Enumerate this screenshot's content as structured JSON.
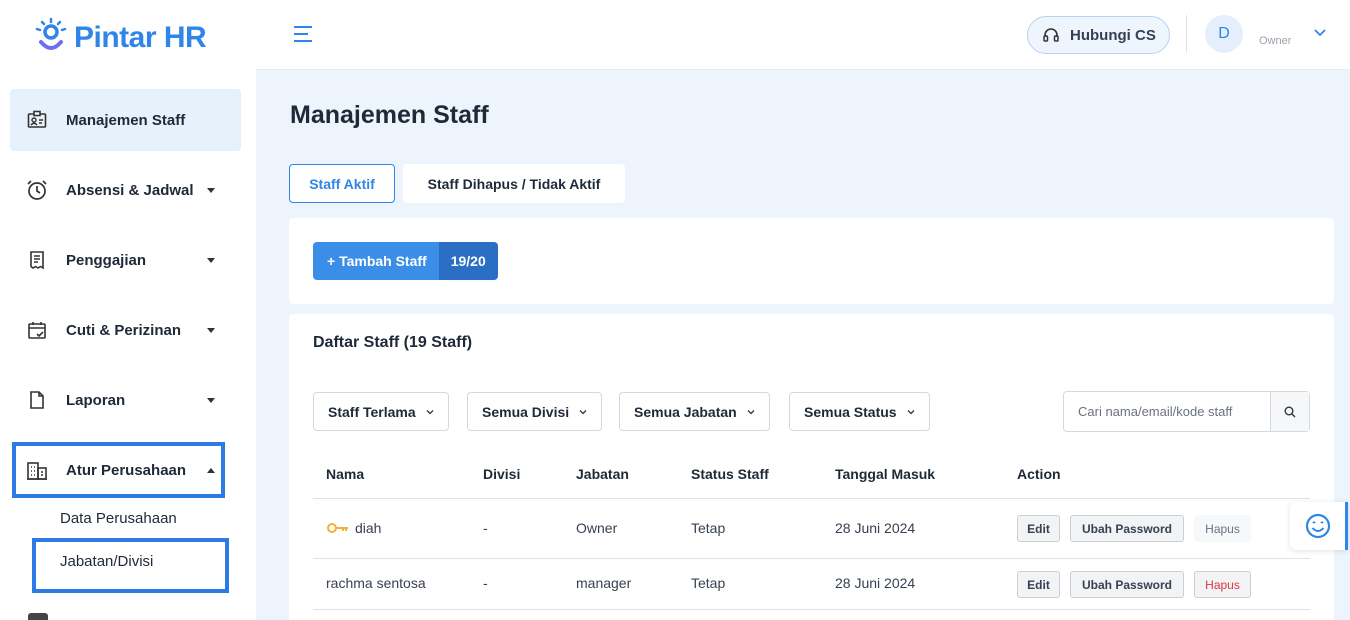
{
  "brand": {
    "name": "Pintar HR",
    "color": "#2f86e8"
  },
  "sidebar": {
    "items": [
      {
        "label": "Manajemen Staff",
        "icon": "id-card-icon"
      },
      {
        "label": "Absensi & Jadwal",
        "icon": "alarm-clock-icon"
      },
      {
        "label": "Penggajian",
        "icon": "receipt-icon"
      },
      {
        "label": "Cuti & Perizinan",
        "icon": "calendar-check-icon"
      },
      {
        "label": "Laporan",
        "icon": "document-icon"
      },
      {
        "label": "Atur Perusahaan",
        "icon": "building-icon"
      }
    ],
    "sub_items": [
      {
        "label": "Data Perusahaan"
      },
      {
        "label": "Jabatan/Divisi"
      }
    ]
  },
  "header": {
    "cs_button": "Hubungi CS",
    "avatar_initial": "D",
    "role": "Owner"
  },
  "main": {
    "title": "Manajemen Staff",
    "tabs": [
      {
        "label": "Staff Aktif"
      },
      {
        "label": "Staff Dihapus / Tidak Aktif"
      }
    ],
    "add_button": {
      "label": "+ Tambah Staff",
      "count": "19/20"
    },
    "list": {
      "title": "Daftar Staff (19 Staff)",
      "filters": [
        {
          "label": "Staff Terlama"
        },
        {
          "label": "Semua Divisi"
        },
        {
          "label": "Semua Jabatan"
        },
        {
          "label": "Semua Status"
        }
      ],
      "search_placeholder": "Cari nama/email/kode staff",
      "columns": [
        "Nama",
        "Divisi",
        "Jabatan",
        "Status Staff",
        "Tanggal Masuk",
        "Action"
      ],
      "rows": [
        {
          "nama": "diah",
          "divisi": "-",
          "jabatan": "Owner",
          "status": "Tetap",
          "tanggal": "28 Juni 2024",
          "owner_key": true
        },
        {
          "nama": "rachma sentosa",
          "divisi": "-",
          "jabatan": "manager",
          "status": "Tetap",
          "tanggal": "28 Juni 2024",
          "owner_key": false
        }
      ],
      "actions": {
        "edit": "Edit",
        "password": "Ubah Password",
        "delete": "Hapus"
      }
    }
  }
}
